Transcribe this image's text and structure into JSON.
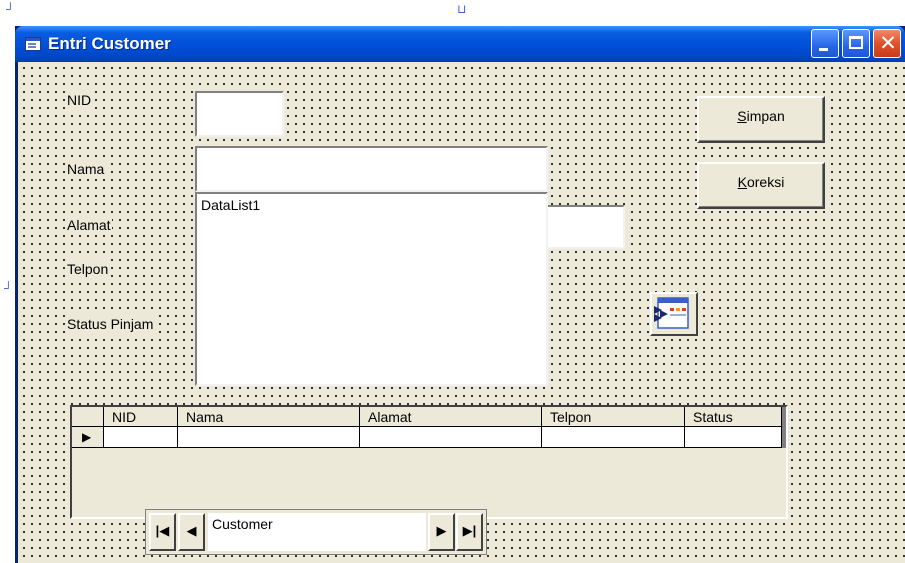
{
  "window": {
    "title": "Entri Customer"
  },
  "labels": {
    "nid": "NID",
    "nama": "Nama",
    "alamat": "Alamat",
    "telpon": "Telpon",
    "status_pinjam": "Status Pinjam"
  },
  "datalist": {
    "caption": "DataList1"
  },
  "buttons": {
    "simpan": {
      "accel": "S",
      "rest": "impan"
    },
    "koreksi": {
      "accel": "K",
      "rest": "oreksi"
    }
  },
  "grid": {
    "columns": [
      "NID",
      "Nama",
      "Alamat",
      "Telpon",
      "Status"
    ],
    "row_indicator": "▶"
  },
  "adodc": {
    "caption": "Customer",
    "first": "|◀",
    "prev": "◀",
    "next": "▶",
    "last": "▶|"
  },
  "icons": {
    "app": "form-icon",
    "adodc_toolbox": "adodc-control-icon"
  },
  "colors": {
    "titlebar": "#0050d8",
    "form_bg": "#ece9d8",
    "close_button": "#e0502a"
  }
}
